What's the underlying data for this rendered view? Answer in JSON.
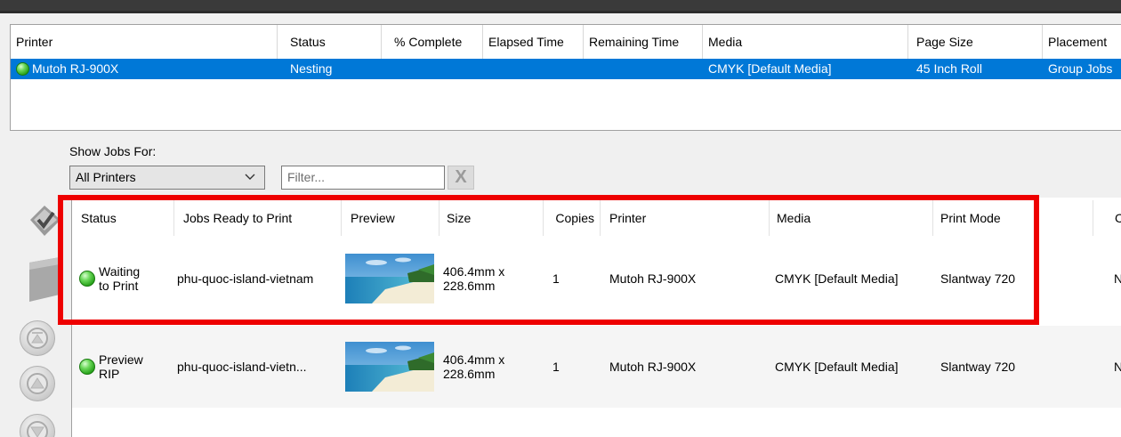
{
  "printer_table": {
    "columns": [
      "Printer",
      "Status",
      "% Complete",
      "Elapsed Time",
      "Remaining Time",
      "Media",
      "Page Size",
      "Placement"
    ],
    "rows": [
      {
        "printer": "Mutoh RJ-900X",
        "status": "Nesting",
        "percent_complete": "",
        "elapsed_time": "",
        "remaining_time": "",
        "media": "CMYK [Default Media]",
        "page_size": "45 Inch Roll",
        "placement": "Group Jobs"
      }
    ]
  },
  "filters": {
    "show_jobs_label": "Show Jobs For:",
    "printer_select_value": "All Printers",
    "filter_placeholder": "Filter...",
    "clear_glyph": "X"
  },
  "jobs_table": {
    "columns": [
      "Status",
      "Jobs Ready to Print",
      "Preview",
      "Size",
      "Copies",
      "Printer",
      "Media",
      "Print Mode",
      "C"
    ],
    "rows": [
      {
        "status": "Waiting to Print",
        "name": "phu-quoc-island-vietnam",
        "size": "406.4mm x 228.6mm",
        "copies": "1",
        "printer": "Mutoh RJ-900X",
        "media": "CMYK [Default Media]",
        "print_mode": "Slantway 720",
        "extra": "N"
      },
      {
        "status": "Preview RIP",
        "name": "phu-quoc-island-vietn...",
        "size": "406.4mm x 228.6mm",
        "copies": "1",
        "printer": "Mutoh RJ-900X",
        "media": "CMYK [Default Media]",
        "print_mode": "Slantway 720",
        "extra": "N"
      }
    ]
  },
  "colors": {
    "selection": "#0078d7",
    "highlight_box": "#ee0000",
    "status_ok": "#2db51e"
  }
}
